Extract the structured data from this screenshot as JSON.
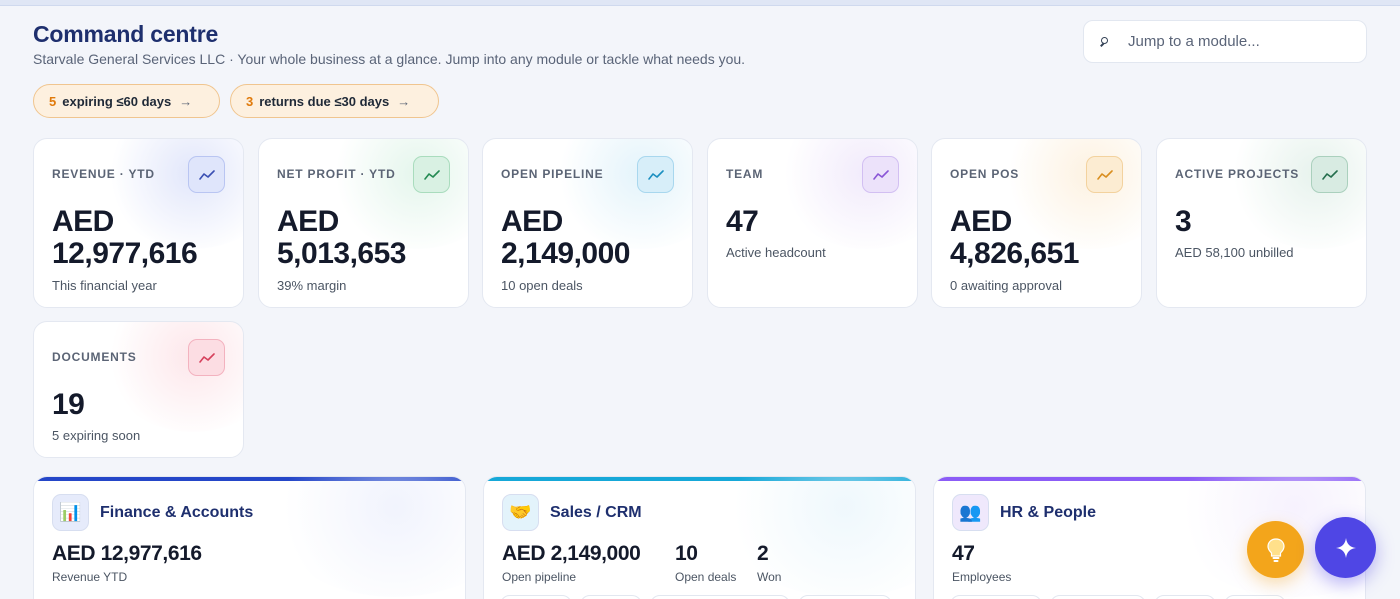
{
  "header": {
    "title": "Command centre",
    "subtitle": "Starvale General Services LLC · Your whole business at a glance. Jump into any module or tackle what needs you."
  },
  "search": {
    "placeholder": "Jump to a module...",
    "icon": "search-icon"
  },
  "alerts": [
    {
      "count": "5",
      "label": "expiring ≤60 days",
      "arrow": "→"
    },
    {
      "count": "3",
      "label": "returns due ≤30 days",
      "arrow": "→"
    }
  ],
  "kpis": [
    {
      "label": "REVENUE · YTD",
      "value_line1": "AED",
      "value_line2": "12,977,616",
      "sub": "This financial year",
      "accent": "#6b7fd7",
      "icon": "trend-icon"
    },
    {
      "label": "NET PROFIT · YTD",
      "value_line1": "AED",
      "value_line2": "5,013,653",
      "sub": "39% margin",
      "accent": "#2f9e62",
      "icon": "trend-icon"
    },
    {
      "label": "OPEN PIPELINE",
      "value_line1": "AED",
      "value_line2": "2,149,000",
      "sub": "10 open deals",
      "accent": "#2aa6d6",
      "icon": "trend-icon"
    },
    {
      "label": "TEAM",
      "value_line1": "47",
      "value_line2": "",
      "sub": "Active headcount",
      "accent": "#9b6be0",
      "icon": "trend-icon"
    },
    {
      "label": "OPEN POS",
      "value_line1": "AED",
      "value_line2": "4,826,651",
      "sub": "0 awaiting approval",
      "accent": "#e6a23c",
      "icon": "trend-icon"
    },
    {
      "label": "ACTIVE PROJECTS",
      "value_line1": "3",
      "value_line2": "",
      "sub": "AED 58,100 unbilled",
      "accent": "#2e7d5b",
      "icon": "trend-icon"
    },
    {
      "label": "DOCUMENTS",
      "value_line1": "19",
      "value_line2": "",
      "sub": "5 expiring soon",
      "accent": "#e0546e",
      "icon": "trend-icon"
    }
  ],
  "modules": [
    {
      "title": "Finance & Accounts",
      "icon": "bar-chart-icon",
      "emoji": "📊",
      "accent": "#2446c8",
      "stats": [
        {
          "value": "AED 12,977,616",
          "label": "Revenue YTD"
        }
      ]
    },
    {
      "title": "Sales / CRM",
      "icon": "handshake-icon",
      "emoji": "🤝",
      "accent": "#16a8d8",
      "stats": [
        {
          "value": "AED 2,149,000",
          "label": "Open pipeline"
        },
        {
          "value": "10",
          "label": "Open deals"
        },
        {
          "value": "2",
          "label": "Won"
        }
      ]
    },
    {
      "title": "HR & People",
      "icon": "people-icon",
      "emoji": "👥",
      "accent": "#8b5cf6",
      "stats": [
        {
          "value": "47",
          "label": "Employees"
        }
      ]
    }
  ],
  "fabs": {
    "tips": "lightbulb-icon",
    "assistant": "sparkle-icon"
  }
}
